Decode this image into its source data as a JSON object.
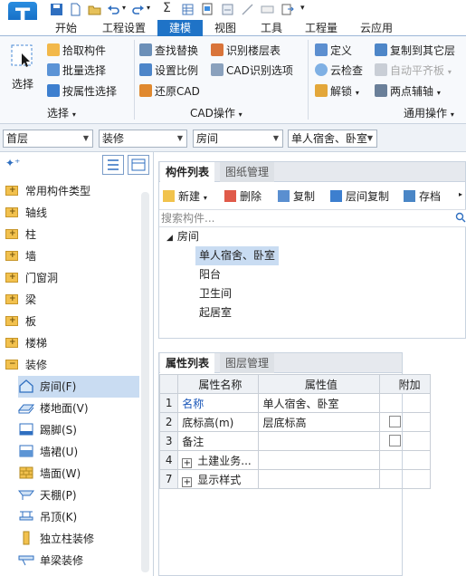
{
  "ribbon_tabs": [
    "开始",
    "工程设置",
    "建模",
    "视图",
    "工具",
    "工程量",
    "云应用"
  ],
  "ribbon": {
    "select_big": "选择",
    "pick_component": "拾取构件",
    "batch_select": "批量选择",
    "select_by_attr": "按属性选择",
    "group_select": "选择",
    "find_replace": "查找替换",
    "set_ratio": "设置比例",
    "restore_cad": "还原CAD",
    "identify_floor_table": "识别楼层表",
    "cad_options": "CAD识别选项",
    "group_cad": "CAD操作",
    "define": "定义",
    "cloud_check": "云检查",
    "unlock": "解锁",
    "copy_to_other_floor": "复制到其它层",
    "auto_level_slab": "自动平齐板",
    "two_point_aux": "两点辅轴",
    "group_common": "通用操作"
  },
  "selectors": [
    "首层",
    "装修",
    "房间",
    "单人宿舍、卧室"
  ],
  "tree": {
    "categories": [
      "常用构件类型",
      "轴线",
      "柱",
      "墙",
      "门窗洞",
      "梁",
      "板",
      "楼梯",
      "装修"
    ],
    "sub_items": [
      "房间(F)",
      "楼地面(V)",
      "踢脚(S)",
      "墙裙(U)",
      "墙面(W)",
      "天棚(P)",
      "吊顶(K)",
      "独立柱装修",
      "单梁装修"
    ]
  },
  "component_panel": {
    "tabs": [
      "构件列表",
      "图纸管理"
    ],
    "toolbar": [
      "新建",
      "删除",
      "复制",
      "层间复制",
      "存档"
    ],
    "search_placeholder": "搜索构件...",
    "root": "房间",
    "items": [
      "单人宿舍、卧室",
      "阳台",
      "卫生间",
      "起居室"
    ]
  },
  "property_panel": {
    "tabs": [
      "属性列表",
      "图层管理"
    ],
    "headers": [
      "属性名称",
      "属性值",
      "附加"
    ],
    "rows": [
      {
        "num": "1",
        "name": "名称",
        "value": "单人宿舍、卧室"
      },
      {
        "num": "2",
        "name": "底标高(m)",
        "value": "层底标高"
      },
      {
        "num": "3",
        "name": "备注",
        "value": ""
      },
      {
        "num": "4",
        "name": "土建业务...",
        "value": ""
      },
      {
        "num": "7",
        "name": "显示样式",
        "value": ""
      }
    ]
  },
  "colors": {
    "accent": "#1f73c7",
    "selection": "#c9dcf2"
  }
}
